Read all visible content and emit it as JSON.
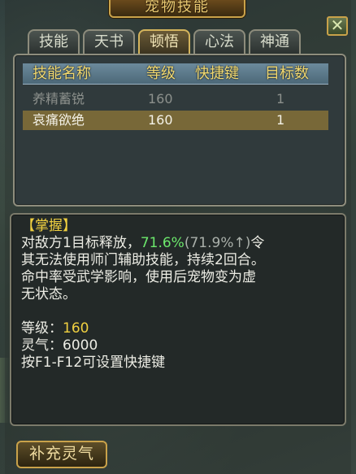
{
  "window": {
    "title": "宠物技能",
    "close_label": "✕"
  },
  "tabs": [
    {
      "label": "技能"
    },
    {
      "label": "天书"
    },
    {
      "label": "顿悟",
      "active": true
    },
    {
      "label": "心法"
    },
    {
      "label": "神通"
    }
  ],
  "skill_list": {
    "headers": [
      "技能名称",
      "等级",
      "快捷键",
      "目标数"
    ],
    "rows": [
      {
        "name": "养精蓄锐",
        "level": "160",
        "hotkey": "",
        "targets": "1",
        "state": "disabled"
      },
      {
        "name": "哀痛欲绝",
        "level": "160",
        "hotkey": "",
        "targets": "1",
        "state": "selected"
      }
    ]
  },
  "detail": {
    "tag": "【掌握】",
    "desc_prefix": "对敌方1目标释放，",
    "desc_value": "71.6%",
    "desc_next": "(71.9%↑)",
    "desc_suffix": "令",
    "line2": "其无法使用师门辅助技能，持续2回合。",
    "line3": "命中率受武学影响，使用后宠物变为虚",
    "line4": "无状态。",
    "level_label": "等级：",
    "level_value": "160",
    "spirit_label": "灵气：",
    "spirit_value": "6000",
    "hotkey_hint": "按F1-F12可设置快捷键"
  },
  "bottom_button": {
    "label": "补充灵气"
  },
  "colors": {
    "accent": "#c9a24a",
    "selected_row": "#786838",
    "header_text": "#f0d870",
    "green_value": "#6ce86c"
  }
}
